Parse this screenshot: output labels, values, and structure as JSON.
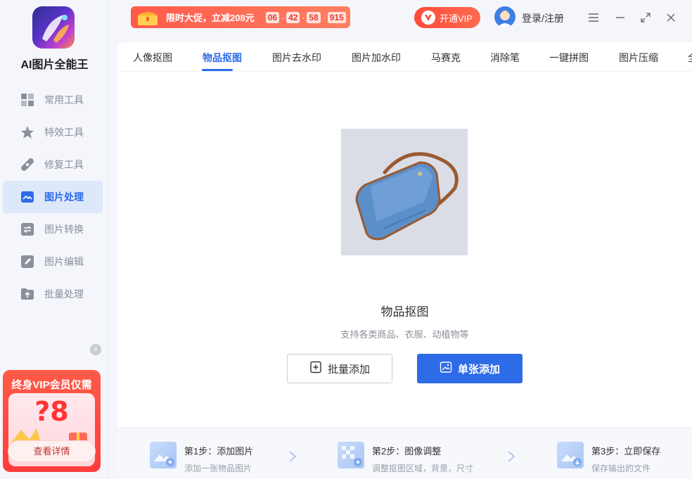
{
  "app": {
    "name": "AI图片全能王"
  },
  "sidebar": {
    "items": [
      {
        "label": "常用工具",
        "icon": "grid-icon"
      },
      {
        "label": "特效工具",
        "icon": "sparkle-star-icon"
      },
      {
        "label": "修复工具",
        "icon": "bandage-icon"
      },
      {
        "label": "图片处理",
        "icon": "image-icon",
        "active": true
      },
      {
        "label": "图片转换",
        "icon": "convert-icon"
      },
      {
        "label": "图片编辑",
        "icon": "edit-image-icon"
      },
      {
        "label": "批量处理",
        "icon": "folder-upload-icon"
      }
    ],
    "promo": {
      "title": "终身VIP会员仅需",
      "price": "?8",
      "button": "查看详情",
      "close": "×"
    }
  },
  "header": {
    "sale": {
      "text": "限时大促，立减208元",
      "countdown": [
        "06",
        "42",
        "58",
        "915"
      ]
    },
    "vip_button": "开通VIP",
    "login": "登录/注册"
  },
  "tabs": [
    {
      "label": "人像抠图"
    },
    {
      "label": "物品抠图",
      "active": true
    },
    {
      "label": "图片去水印"
    },
    {
      "label": "图片加水印"
    },
    {
      "label": "马赛克"
    },
    {
      "label": "消除笔"
    },
    {
      "label": "一键拼图"
    },
    {
      "label": "图片压缩"
    },
    {
      "label": "全"
    }
  ],
  "main": {
    "title": "物品抠图",
    "subtitle": "支持各类商品、衣服、动植物等",
    "batch_button": "批量添加",
    "single_button": "单张添加"
  },
  "steps": [
    {
      "title": "第1步：添加图片",
      "desc": "添加一张物品图片"
    },
    {
      "title": "第2步：图像调整",
      "desc": "调整抠图区域，背景，尺寸"
    },
    {
      "title": "第3步：立即保存",
      "desc": "保存输出的文件"
    }
  ],
  "colors": {
    "accent": "#2e6be6",
    "promo": "#ff3d3d",
    "vip": "#ff4a3a"
  }
}
